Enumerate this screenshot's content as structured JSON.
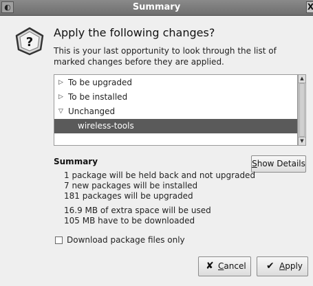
{
  "window": {
    "title": "Summary",
    "menu_glyph": "◐",
    "close_glyph": "X"
  },
  "header": {
    "icon": "warning-question-icon",
    "icon_glyph": "?",
    "heading": "Apply the following changes?",
    "description": "This is your last opportunity to look through the list of marked changes before they are applied."
  },
  "tree": {
    "rows": [
      {
        "expander": "▷",
        "label": "To be upgraded"
      },
      {
        "expander": "▷",
        "label": "To be installed"
      },
      {
        "expander": "▽",
        "label": "Unchanged"
      },
      {
        "expander": "",
        "label": "wireless-tools",
        "selected": true
      }
    ]
  },
  "summary": {
    "title": "Summary",
    "show_details_prefix": "S",
    "show_details_rest": "how Details",
    "lines": [
      "1 package will be held back and not upgraded",
      "7 new packages will be installed",
      "181 packages will be upgraded",
      "16.9 MB of extra space will be used",
      "105 MB have to be downloaded"
    ]
  },
  "options": {
    "download_only_label": "Download package files only",
    "download_only_checked": false
  },
  "buttons": {
    "cancel_icon": "✘",
    "cancel_prefix": "C",
    "cancel_rest": "ancel",
    "apply_icon": "✔",
    "apply_prefix": "A",
    "apply_rest": "pply"
  }
}
